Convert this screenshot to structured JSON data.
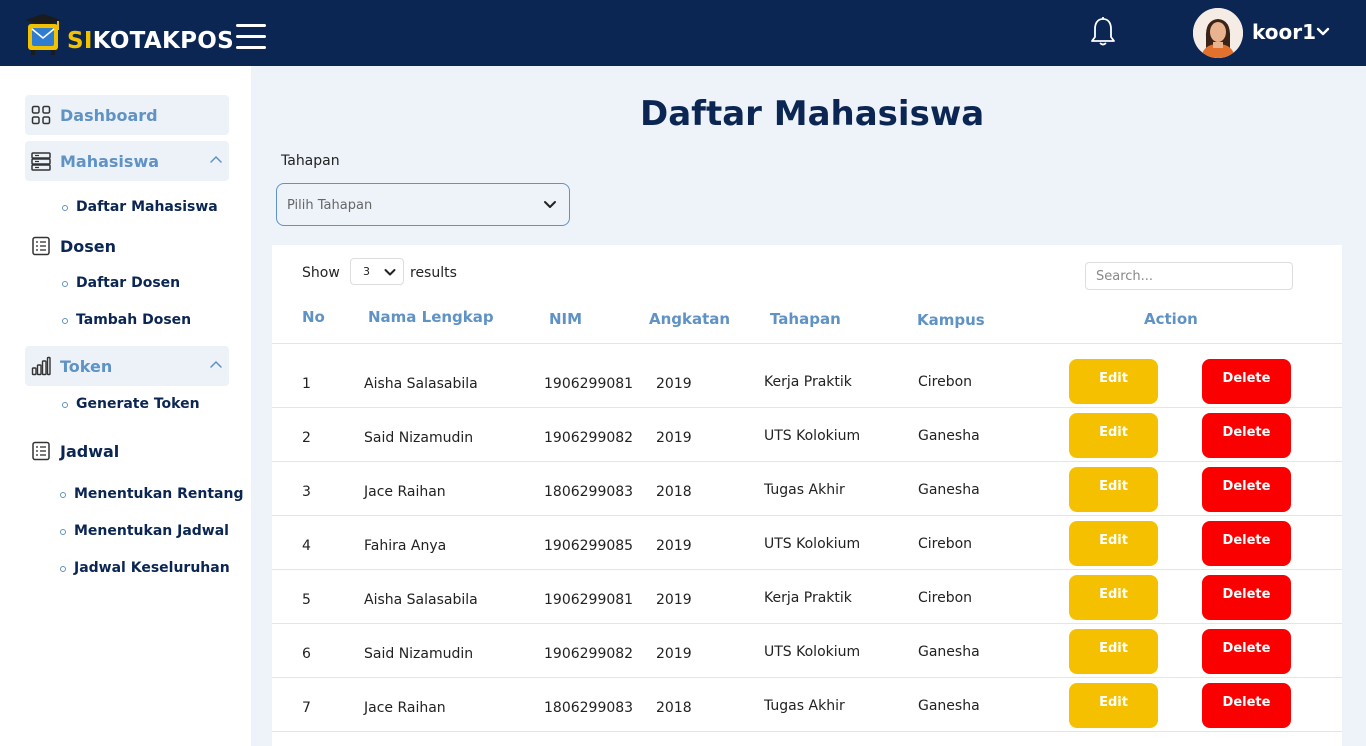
{
  "app": {
    "logo_prefix": "SI",
    "logo_suffix": "KOTAKPOS"
  },
  "user": {
    "name": "koor1"
  },
  "sidebar": {
    "dashboard": "Dashboard",
    "mahasiswa": {
      "label": "Mahasiswa",
      "items": [
        "Daftar Mahasiswa"
      ]
    },
    "dosen": {
      "label": "Dosen",
      "items": [
        "Daftar Dosen",
        "Tambah Dosen"
      ]
    },
    "token": {
      "label": "Token",
      "items": [
        "Generate Token"
      ]
    },
    "jadwal": {
      "label": "Jadwal",
      "items": [
        "Menentukan Rentang",
        "Menentukan Jadwal",
        "Jadwal Keseluruhan"
      ]
    }
  },
  "page": {
    "title": "Daftar Mahasiswa",
    "filter_label": "Tahapan",
    "filter_placeholder": "Pilih Tahapan"
  },
  "table_controls": {
    "show_label": "Show",
    "per_page": "3",
    "results_label": "results",
    "search_placeholder": "Search..."
  },
  "table": {
    "columns": [
      "No",
      "Nama Lengkap",
      "NIM",
      "Angkatan",
      "Tahapan",
      "Kampus",
      "Action"
    ],
    "edit_label": "Edit",
    "delete_label": "Delete",
    "rows": [
      {
        "no": "1",
        "nama": "Aisha Salasabila",
        "nim": "1906299081",
        "angkatan": "2019",
        "tahapan": "Kerja Praktik",
        "kampus": "Cirebon"
      },
      {
        "no": "2",
        "nama": "Said Nizamudin",
        "nim": "1906299082",
        "angkatan": "2019",
        "tahapan": "UTS Kolokium",
        "kampus": "Ganesha"
      },
      {
        "no": "3",
        "nama": "Jace Raihan",
        "nim": "1806299083",
        "angkatan": "2018",
        "tahapan": "Tugas Akhir",
        "kampus": "Ganesha"
      },
      {
        "no": "4",
        "nama": "Fahira Anya",
        "nim": "1906299085",
        "angkatan": "2019",
        "tahapan": "UTS Kolokium",
        "kampus": "Cirebon"
      },
      {
        "no": "5",
        "nama": "Aisha Salasabila",
        "nim": "1906299081",
        "angkatan": "2019",
        "tahapan": "Kerja Praktik",
        "kampus": "Cirebon"
      },
      {
        "no": "6",
        "nama": "Said Nizamudin",
        "nim": "1906299082",
        "angkatan": "2019",
        "tahapan": "UTS Kolokium",
        "kampus": "Ganesha"
      },
      {
        "no": "7",
        "nama": "Jace Raihan",
        "nim": "1806299083",
        "angkatan": "2018",
        "tahapan": "Tugas Akhir",
        "kampus": "Ganesha"
      }
    ]
  },
  "colors": {
    "navy": "#0b2653",
    "accent_blue": "#5f92c5",
    "edit": "#f4c000",
    "delete": "#fb0000",
    "logo_yellow": "#f2c200"
  },
  "icons": [
    "mailbox-logo-icon",
    "hamburger-icon",
    "bell-icon",
    "chevron-down-icon",
    "grid-icon",
    "server-icon",
    "document-list-icon",
    "bar-chart-icon",
    "chevron-up-icon"
  ]
}
